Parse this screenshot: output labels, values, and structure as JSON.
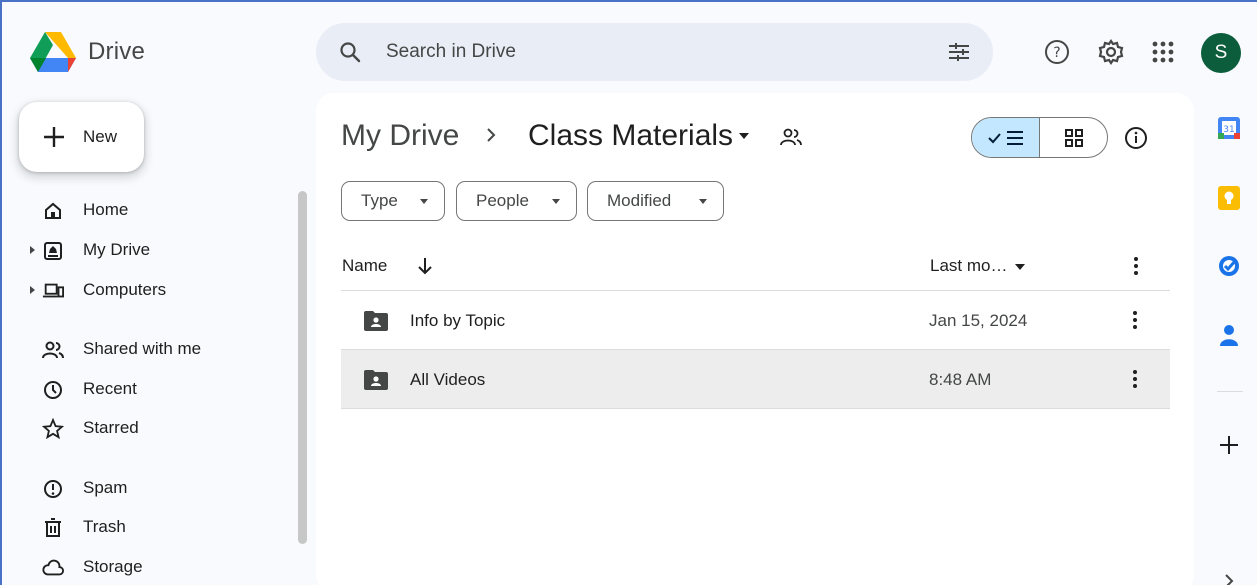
{
  "app": {
    "name": "Drive"
  },
  "search": {
    "placeholder": "Search in Drive"
  },
  "header_icons": [
    "help-icon",
    "settings-icon",
    "apps-icon"
  ],
  "account": {
    "avatar_letter": "S",
    "color": "#0b5d3b"
  },
  "new_button": {
    "label": "New"
  },
  "sidebar": {
    "items": [
      {
        "label": "Home",
        "icon": "home-icon"
      },
      {
        "label": "My Drive",
        "icon": "my-drive-icon",
        "expandable": true
      },
      {
        "label": "Computers",
        "icon": "computers-icon",
        "expandable": true
      },
      {
        "label": "Shared with me",
        "icon": "shared-icon"
      },
      {
        "label": "Recent",
        "icon": "recent-icon"
      },
      {
        "label": "Starred",
        "icon": "star-icon"
      },
      {
        "label": "Spam",
        "icon": "spam-icon"
      },
      {
        "label": "Trash",
        "icon": "trash-icon"
      },
      {
        "label": "Storage",
        "icon": "cloud-icon"
      }
    ]
  },
  "breadcrumb": {
    "root": "My Drive",
    "current": "Class Materials"
  },
  "filters": [
    "Type",
    "People",
    "Modified"
  ],
  "table": {
    "columns": {
      "name": "Name",
      "modified": "Last mo…"
    },
    "rows": [
      {
        "name": "Info by Topic",
        "modified": "Jan 15, 2024",
        "selected": false
      },
      {
        "name": "All Videos",
        "modified": "8:48 AM",
        "selected": true
      }
    ]
  },
  "colors": {
    "accent": "#c2e7ff",
    "search_bg": "#e9eef6",
    "page_bg": "#f8fafd",
    "selected_row": "#ededed"
  },
  "right_rail": [
    "calendar-icon",
    "keep-icon",
    "tasks-icon",
    "contacts-icon",
    "add-icon",
    "chevron-right-icon"
  ]
}
